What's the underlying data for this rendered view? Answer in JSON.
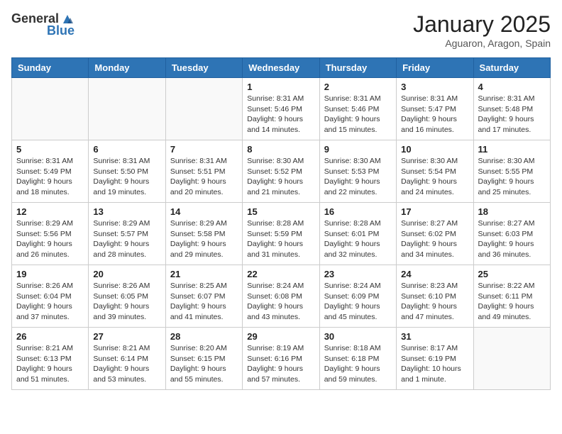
{
  "header": {
    "logo_general": "General",
    "logo_blue": "Blue",
    "month": "January 2025",
    "location": "Aguaron, Aragon, Spain"
  },
  "weekdays": [
    "Sunday",
    "Monday",
    "Tuesday",
    "Wednesday",
    "Thursday",
    "Friday",
    "Saturday"
  ],
  "weeks": [
    [
      {
        "day": "",
        "info": ""
      },
      {
        "day": "",
        "info": ""
      },
      {
        "day": "",
        "info": ""
      },
      {
        "day": "1",
        "info": "Sunrise: 8:31 AM\nSunset: 5:46 PM\nDaylight: 9 hours\nand 14 minutes."
      },
      {
        "day": "2",
        "info": "Sunrise: 8:31 AM\nSunset: 5:46 PM\nDaylight: 9 hours\nand 15 minutes."
      },
      {
        "day": "3",
        "info": "Sunrise: 8:31 AM\nSunset: 5:47 PM\nDaylight: 9 hours\nand 16 minutes."
      },
      {
        "day": "4",
        "info": "Sunrise: 8:31 AM\nSunset: 5:48 PM\nDaylight: 9 hours\nand 17 minutes."
      }
    ],
    [
      {
        "day": "5",
        "info": "Sunrise: 8:31 AM\nSunset: 5:49 PM\nDaylight: 9 hours\nand 18 minutes."
      },
      {
        "day": "6",
        "info": "Sunrise: 8:31 AM\nSunset: 5:50 PM\nDaylight: 9 hours\nand 19 minutes."
      },
      {
        "day": "7",
        "info": "Sunrise: 8:31 AM\nSunset: 5:51 PM\nDaylight: 9 hours\nand 20 minutes."
      },
      {
        "day": "8",
        "info": "Sunrise: 8:30 AM\nSunset: 5:52 PM\nDaylight: 9 hours\nand 21 minutes."
      },
      {
        "day": "9",
        "info": "Sunrise: 8:30 AM\nSunset: 5:53 PM\nDaylight: 9 hours\nand 22 minutes."
      },
      {
        "day": "10",
        "info": "Sunrise: 8:30 AM\nSunset: 5:54 PM\nDaylight: 9 hours\nand 24 minutes."
      },
      {
        "day": "11",
        "info": "Sunrise: 8:30 AM\nSunset: 5:55 PM\nDaylight: 9 hours\nand 25 minutes."
      }
    ],
    [
      {
        "day": "12",
        "info": "Sunrise: 8:29 AM\nSunset: 5:56 PM\nDaylight: 9 hours\nand 26 minutes."
      },
      {
        "day": "13",
        "info": "Sunrise: 8:29 AM\nSunset: 5:57 PM\nDaylight: 9 hours\nand 28 minutes."
      },
      {
        "day": "14",
        "info": "Sunrise: 8:29 AM\nSunset: 5:58 PM\nDaylight: 9 hours\nand 29 minutes."
      },
      {
        "day": "15",
        "info": "Sunrise: 8:28 AM\nSunset: 5:59 PM\nDaylight: 9 hours\nand 31 minutes."
      },
      {
        "day": "16",
        "info": "Sunrise: 8:28 AM\nSunset: 6:01 PM\nDaylight: 9 hours\nand 32 minutes."
      },
      {
        "day": "17",
        "info": "Sunrise: 8:27 AM\nSunset: 6:02 PM\nDaylight: 9 hours\nand 34 minutes."
      },
      {
        "day": "18",
        "info": "Sunrise: 8:27 AM\nSunset: 6:03 PM\nDaylight: 9 hours\nand 36 minutes."
      }
    ],
    [
      {
        "day": "19",
        "info": "Sunrise: 8:26 AM\nSunset: 6:04 PM\nDaylight: 9 hours\nand 37 minutes."
      },
      {
        "day": "20",
        "info": "Sunrise: 8:26 AM\nSunset: 6:05 PM\nDaylight: 9 hours\nand 39 minutes."
      },
      {
        "day": "21",
        "info": "Sunrise: 8:25 AM\nSunset: 6:07 PM\nDaylight: 9 hours\nand 41 minutes."
      },
      {
        "day": "22",
        "info": "Sunrise: 8:24 AM\nSunset: 6:08 PM\nDaylight: 9 hours\nand 43 minutes."
      },
      {
        "day": "23",
        "info": "Sunrise: 8:24 AM\nSunset: 6:09 PM\nDaylight: 9 hours\nand 45 minutes."
      },
      {
        "day": "24",
        "info": "Sunrise: 8:23 AM\nSunset: 6:10 PM\nDaylight: 9 hours\nand 47 minutes."
      },
      {
        "day": "25",
        "info": "Sunrise: 8:22 AM\nSunset: 6:11 PM\nDaylight: 9 hours\nand 49 minutes."
      }
    ],
    [
      {
        "day": "26",
        "info": "Sunrise: 8:21 AM\nSunset: 6:13 PM\nDaylight: 9 hours\nand 51 minutes."
      },
      {
        "day": "27",
        "info": "Sunrise: 8:21 AM\nSunset: 6:14 PM\nDaylight: 9 hours\nand 53 minutes."
      },
      {
        "day": "28",
        "info": "Sunrise: 8:20 AM\nSunset: 6:15 PM\nDaylight: 9 hours\nand 55 minutes."
      },
      {
        "day": "29",
        "info": "Sunrise: 8:19 AM\nSunset: 6:16 PM\nDaylight: 9 hours\nand 57 minutes."
      },
      {
        "day": "30",
        "info": "Sunrise: 8:18 AM\nSunset: 6:18 PM\nDaylight: 9 hours\nand 59 minutes."
      },
      {
        "day": "31",
        "info": "Sunrise: 8:17 AM\nSunset: 6:19 PM\nDaylight: 10 hours\nand 1 minute."
      },
      {
        "day": "",
        "info": ""
      }
    ]
  ]
}
